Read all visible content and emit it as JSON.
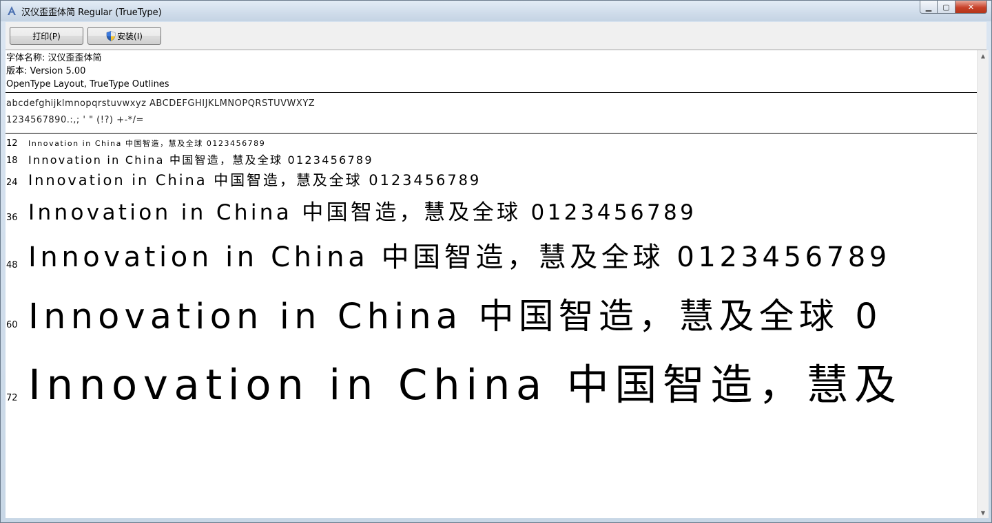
{
  "window": {
    "title": "汉仪歪歪体简 Regular (TrueType)",
    "controls": {
      "minimize": "▁",
      "maximize": "▢",
      "close": "✕"
    }
  },
  "toolbar": {
    "print_label": "打印(P)",
    "install_label": "安装(I)"
  },
  "font_info": {
    "name_line": "字体名称: 汉仪歪歪体简",
    "version_line": "版本: Version 5.00",
    "type_line": "OpenType Layout, TrueType Outlines"
  },
  "charset": {
    "line1": "abcdefghijklmnopqrstuvwxyz ABCDEFGHIJKLMNOPQRSTUVWXYZ",
    "line2": "1234567890.:,; ' \" (!?) +-*/="
  },
  "samples": [
    {
      "size": "12",
      "text": "Innovation in China 中国智造，慧及全球 0123456789"
    },
    {
      "size": "18",
      "text": "Innovation in China 中国智造，慧及全球 0123456789"
    },
    {
      "size": "24",
      "text": "Innovation in China 中国智造，慧及全球 0123456789"
    },
    {
      "size": "36",
      "text": "Innovation in China 中国智造，慧及全球 0123456789"
    },
    {
      "size": "48",
      "text": "Innovation in China 中国智造，慧及全球 0123456789"
    },
    {
      "size": "60",
      "text": "Innovation in China 中国智造，慧及全球 0"
    },
    {
      "size": "72",
      "text": "Innovation in China 中国智造，慧及"
    }
  ],
  "icons": {
    "app": "font-viewer-icon",
    "install": "uac-shield-icon"
  }
}
